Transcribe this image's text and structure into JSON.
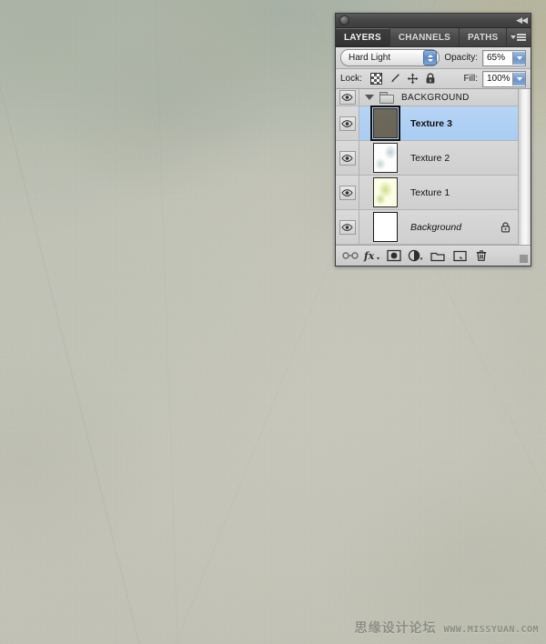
{
  "canvas": {
    "description": "light green-grey grunge paper texture background",
    "base_color": "#eef0e7",
    "accent_top_right": "#e8dea2"
  },
  "watermark": {
    "chinese": "思缘设计论坛",
    "url": "WWW.MISSYUAN.COM"
  },
  "panel": {
    "titlebar": {
      "collapse_icon": "collapse-double-arrow"
    },
    "tabs": [
      {
        "label": "LAYERS",
        "active": true
      },
      {
        "label": "CHANNELS",
        "active": false
      },
      {
        "label": "PATHS",
        "active": false
      }
    ],
    "menu_icon": "panel-menu-icon",
    "blend_row": {
      "blend_mode": "Hard Light",
      "opacity_label": "Opacity:",
      "opacity_value": "65%"
    },
    "lock_row": {
      "lock_label": "Lock:",
      "lock_icons": [
        "lock-transparent-pixels-icon",
        "lock-image-pixels-icon",
        "lock-position-icon",
        "lock-all-icon"
      ],
      "fill_label": "Fill:",
      "fill_value": "100%"
    },
    "layers": [
      {
        "type": "group",
        "name": "BACKGROUND",
        "visible": true,
        "expanded": true,
        "selected": false
      },
      {
        "type": "layer",
        "name": "Texture 3",
        "visible": true,
        "selected": true,
        "thumb": "texture-3-thumbnail",
        "bold": true,
        "italic": false,
        "locked": false
      },
      {
        "type": "layer",
        "name": "Texture 2",
        "visible": true,
        "selected": false,
        "thumb": "texture-2-thumbnail",
        "bold": false,
        "italic": false,
        "locked": false
      },
      {
        "type": "layer",
        "name": "Texture 1",
        "visible": true,
        "selected": false,
        "thumb": "texture-1-thumbnail",
        "bold": false,
        "italic": false,
        "locked": false
      },
      {
        "type": "layer",
        "name": "Background",
        "visible": true,
        "selected": false,
        "thumb": "white-thumbnail",
        "bold": false,
        "italic": true,
        "locked": true
      }
    ],
    "bottom_toolbar": [
      "link-layers-icon",
      "layer-style-fx-icon",
      "add-layer-mask-icon",
      "new-fill-adjustment-layer-icon",
      "new-group-icon",
      "new-layer-icon",
      "delete-layer-icon"
    ],
    "colors": {
      "selection": "#aed0f4",
      "panel_bg": "#d4d4d4",
      "chrome_dark": "#454545"
    }
  }
}
